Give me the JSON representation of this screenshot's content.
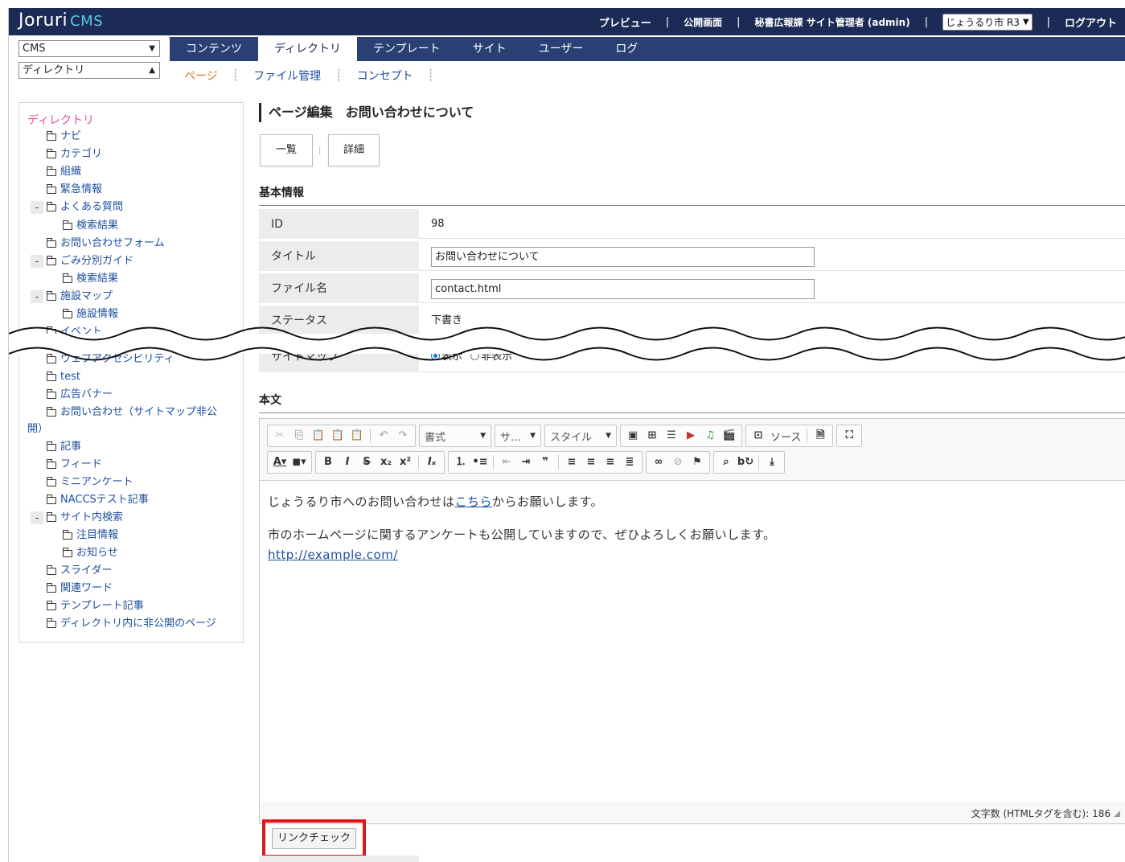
{
  "header": {
    "logo_main": "Joruri",
    "logo_sub": "CMS",
    "preview": "プレビュー",
    "public": "公開画面",
    "user": "秘書広報課 サイト管理者 (admin)",
    "site": "じょうるり市 R3",
    "logout": "ログアウト"
  },
  "left_selects": {
    "cms": "CMS",
    "dir": "ディレクトリ"
  },
  "tabs": [
    "コンテンツ",
    "ディレクトリ",
    "テンプレート",
    "サイト",
    "ユーザー",
    "ログ"
  ],
  "subtabs": [
    "ページ",
    "ファイル管理",
    "コンセプト"
  ],
  "tree": {
    "root": "ディレクトリ",
    "items": [
      "ナビ",
      "カテゴリ",
      "組織",
      "緊急情報",
      "よくある質問",
      "検索結果",
      "お問い合わせフォーム",
      "ごみ分別ガイド",
      "検索結果",
      "施設マップ",
      "施設情報",
      "イベント",
      "ウェブアクセシビリティ",
      "test",
      "広告バナー",
      "お問い合わせ（サイトマップ非公",
      "開）",
      "記事",
      "フィード",
      "ミニアンケート",
      "NACCSテスト記事",
      "サイト内検索",
      "注目情報",
      "お知らせ",
      "スライダー",
      "関連ワード",
      "テンプレート記事",
      "ディレクトリ内に非公開のページ"
    ],
    "expander": "-"
  },
  "page": {
    "title_prefix": "ページ編集",
    "title": "お問い合わせについて",
    "btn_list": "一覧",
    "btn_detail": "詳細"
  },
  "basic": {
    "heading": "基本情報",
    "id_label": "ID",
    "id_value": "98",
    "title_label": "タイトル",
    "title_value": "お問い合わせについて",
    "file_label": "ファイル名",
    "file_value": "contact.html",
    "status_label": "ステータス",
    "status_value": "下書き",
    "sitemap_label": "サイトマップ",
    "sitemap_show": "表示",
    "sitemap_hide": "非表示"
  },
  "body": {
    "heading": "本文",
    "toolbar": {
      "format": "書式",
      "size": "サ...",
      "style": "スタイル",
      "source": "ソース"
    },
    "p1_before": "じょうるり市へのお問い合わせは",
    "p1_link": "こちら",
    "p1_after": "からお願いします。",
    "p2": "市のホームページに関するアンケートも公開していますので、ぜひよろしくお願いします。",
    "url": "http://example.com/",
    "char_count": "文字数 (HTMLタグを含む): 186"
  },
  "link_check": "リンクチェック",
  "colors": {
    "header_bg": "#1c2b55",
    "tabs_bg": "#2a3f73",
    "highlight": "#e0151a",
    "link": "#1e4fa0",
    "tree_root": "#e04fa0",
    "active_subtab": "#e07a1f"
  }
}
